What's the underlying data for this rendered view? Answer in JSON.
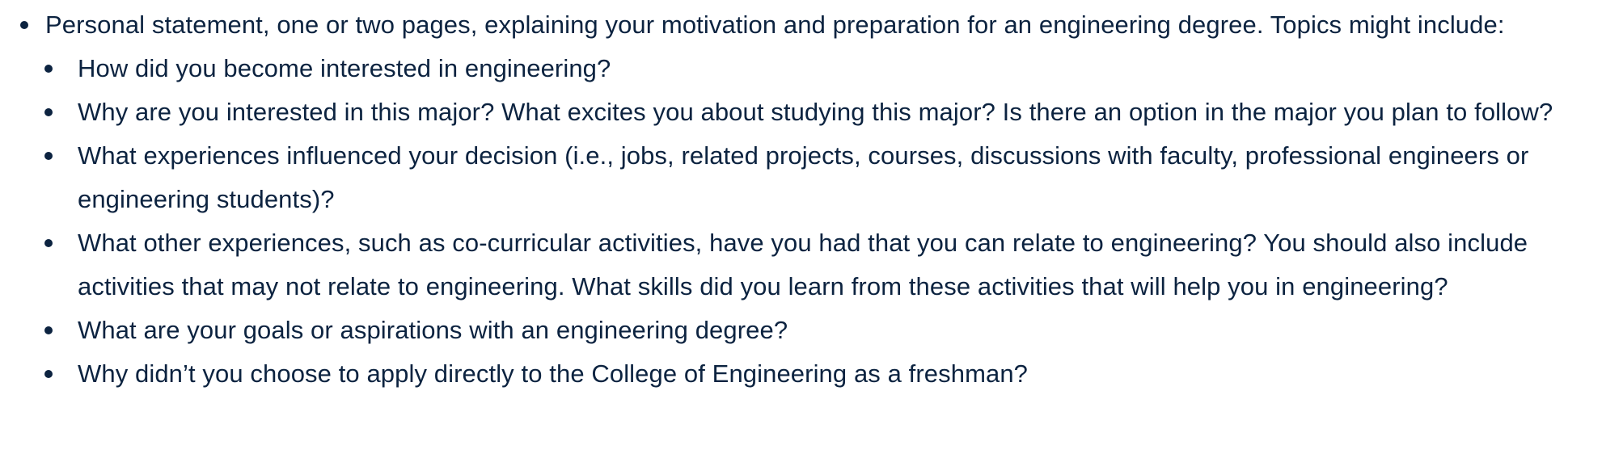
{
  "main_item": {
    "text": "Personal statement, one or two pages, explaining your motivation and preparation for an engineering degree. Topics might include:"
  },
  "topics": [
    {
      "text": "How did you become interested in engineering?"
    },
    {
      "text": "Why are you interested in this major? What excites you about studying this major? Is there an option in the major you plan to follow?"
    },
    {
      "text": "What experiences influenced your decision (i.e., jobs, related projects, courses, discussions with faculty, professional engineers or engineering students)?"
    },
    {
      "text": "What other experiences, such as co-curricular activities, have you had that you can relate to engineering? You should also include activities that may not relate to engineering. What skills did you learn from these activities that will help you in engineering?"
    },
    {
      "text": "What are your goals or aspirations with an engineering degree?"
    },
    {
      "text": "Why didn’t you choose to apply directly to the College of Engineering as a freshman?"
    }
  ],
  "colors": {
    "text": "#0c2340",
    "background": "#ffffff"
  }
}
